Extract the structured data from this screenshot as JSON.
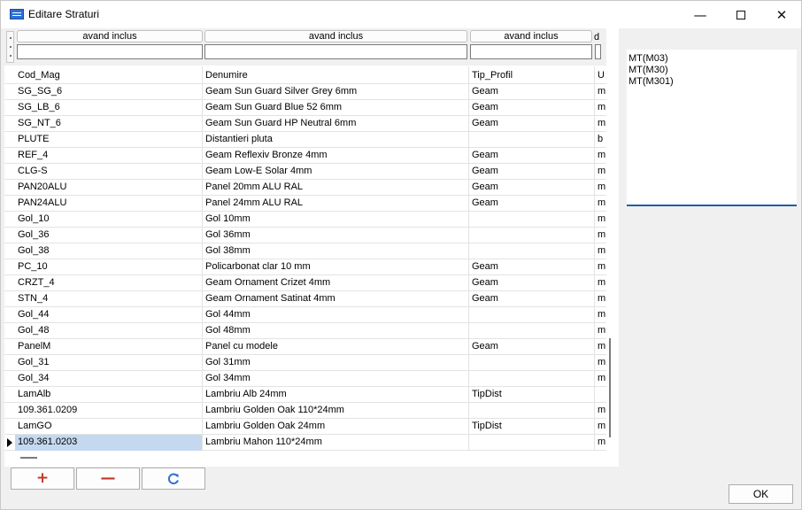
{
  "window": {
    "title": "Editare Straturi"
  },
  "filters": {
    "col1_label": "avand inclus",
    "col2_label": "avand inclus",
    "col3_label": "avand inclus",
    "col4_label": "d"
  },
  "columns": [
    "Cod_Mag",
    "Denumire",
    "Tip_Profil",
    "U"
  ],
  "rows": [
    [
      "SG_SG_6",
      "Geam Sun Guard Silver Grey 6mm",
      "Geam",
      "m"
    ],
    [
      "SG_LB_6",
      "Geam Sun Guard Blue 52 6mm",
      "Geam",
      "m"
    ],
    [
      "SG_NT_6",
      "Geam Sun Guard HP Neutral 6mm",
      "Geam",
      "m"
    ],
    [
      "PLUTE",
      "Distantieri pluta",
      "",
      "b"
    ],
    [
      "REF_4",
      "Geam Reflexiv Bronze 4mm",
      "Geam",
      "m"
    ],
    [
      "CLG-S",
      "Geam Low-E Solar 4mm",
      "Geam",
      "m"
    ],
    [
      "PAN20ALU",
      "Panel 20mm ALU RAL",
      "Geam",
      "m"
    ],
    [
      "PAN24ALU",
      "Panel 24mm ALU RAL",
      "Geam",
      "m"
    ],
    [
      "Gol_10",
      "Gol 10mm",
      "",
      "m"
    ],
    [
      "Gol_36",
      "Gol 36mm",
      "",
      "m"
    ],
    [
      "Gol_38",
      "Gol 38mm",
      "",
      "m"
    ],
    [
      "PC_10",
      "Policarbonat clar 10 mm",
      "Geam",
      "m"
    ],
    [
      "CRZT_4",
      "Geam Ornament Crizet 4mm",
      "Geam",
      "m"
    ],
    [
      "STN_4",
      "Geam Ornament Satinat 4mm",
      "Geam",
      "m"
    ],
    [
      "Gol_44",
      "Gol 44mm",
      "",
      "m"
    ],
    [
      "Gol_48",
      "Gol 48mm",
      "",
      "m"
    ],
    [
      "PanelM",
      "Panel cu modele",
      "Geam",
      "m"
    ],
    [
      "Gol_31",
      "Gol 31mm",
      "",
      "m"
    ],
    [
      "Gol_34",
      "Gol 34mm",
      "",
      "m"
    ],
    [
      "LamAlb",
      "Lambriu Alb 24mm",
      "TipDist",
      ""
    ],
    [
      "109.361.0209",
      "Lambriu Golden Oak 110*24mm",
      "",
      "m"
    ],
    [
      "LamGO",
      "Lambriu Golden Oak 24mm",
      "TipDist",
      "m"
    ],
    [
      "109.361.0203",
      "Lambriu Mahon 110*24mm",
      "",
      "m"
    ]
  ],
  "selected_row_index": 22,
  "right_list": [
    "MT(M03)",
    "MT(M30)",
    "MT(M301)"
  ],
  "buttons": {
    "ok": "OK"
  },
  "icons": {
    "add": "plus-icon",
    "remove": "minus-icon",
    "refresh": "refresh-icon",
    "accent": "#c0392b",
    "selection": "#c4d9ef"
  }
}
